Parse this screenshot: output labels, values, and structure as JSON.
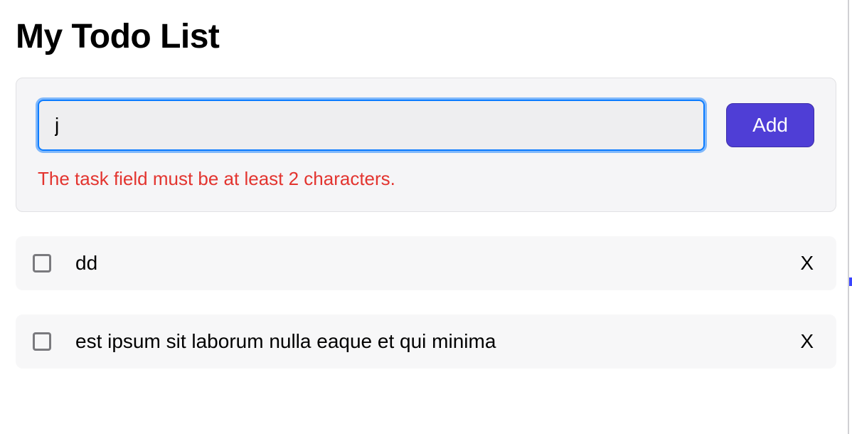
{
  "header": {
    "title": "My Todo List"
  },
  "form": {
    "task_value": "j",
    "task_placeholder": "",
    "add_label": "Add",
    "error_message": "The task field must be at least 2 characters."
  },
  "delete_icon_glyph": "X",
  "todos": [
    {
      "text": "dd",
      "done": false
    },
    {
      "text": "est ipsum sit laborum nulla eaque et qui minima",
      "done": false
    }
  ]
}
